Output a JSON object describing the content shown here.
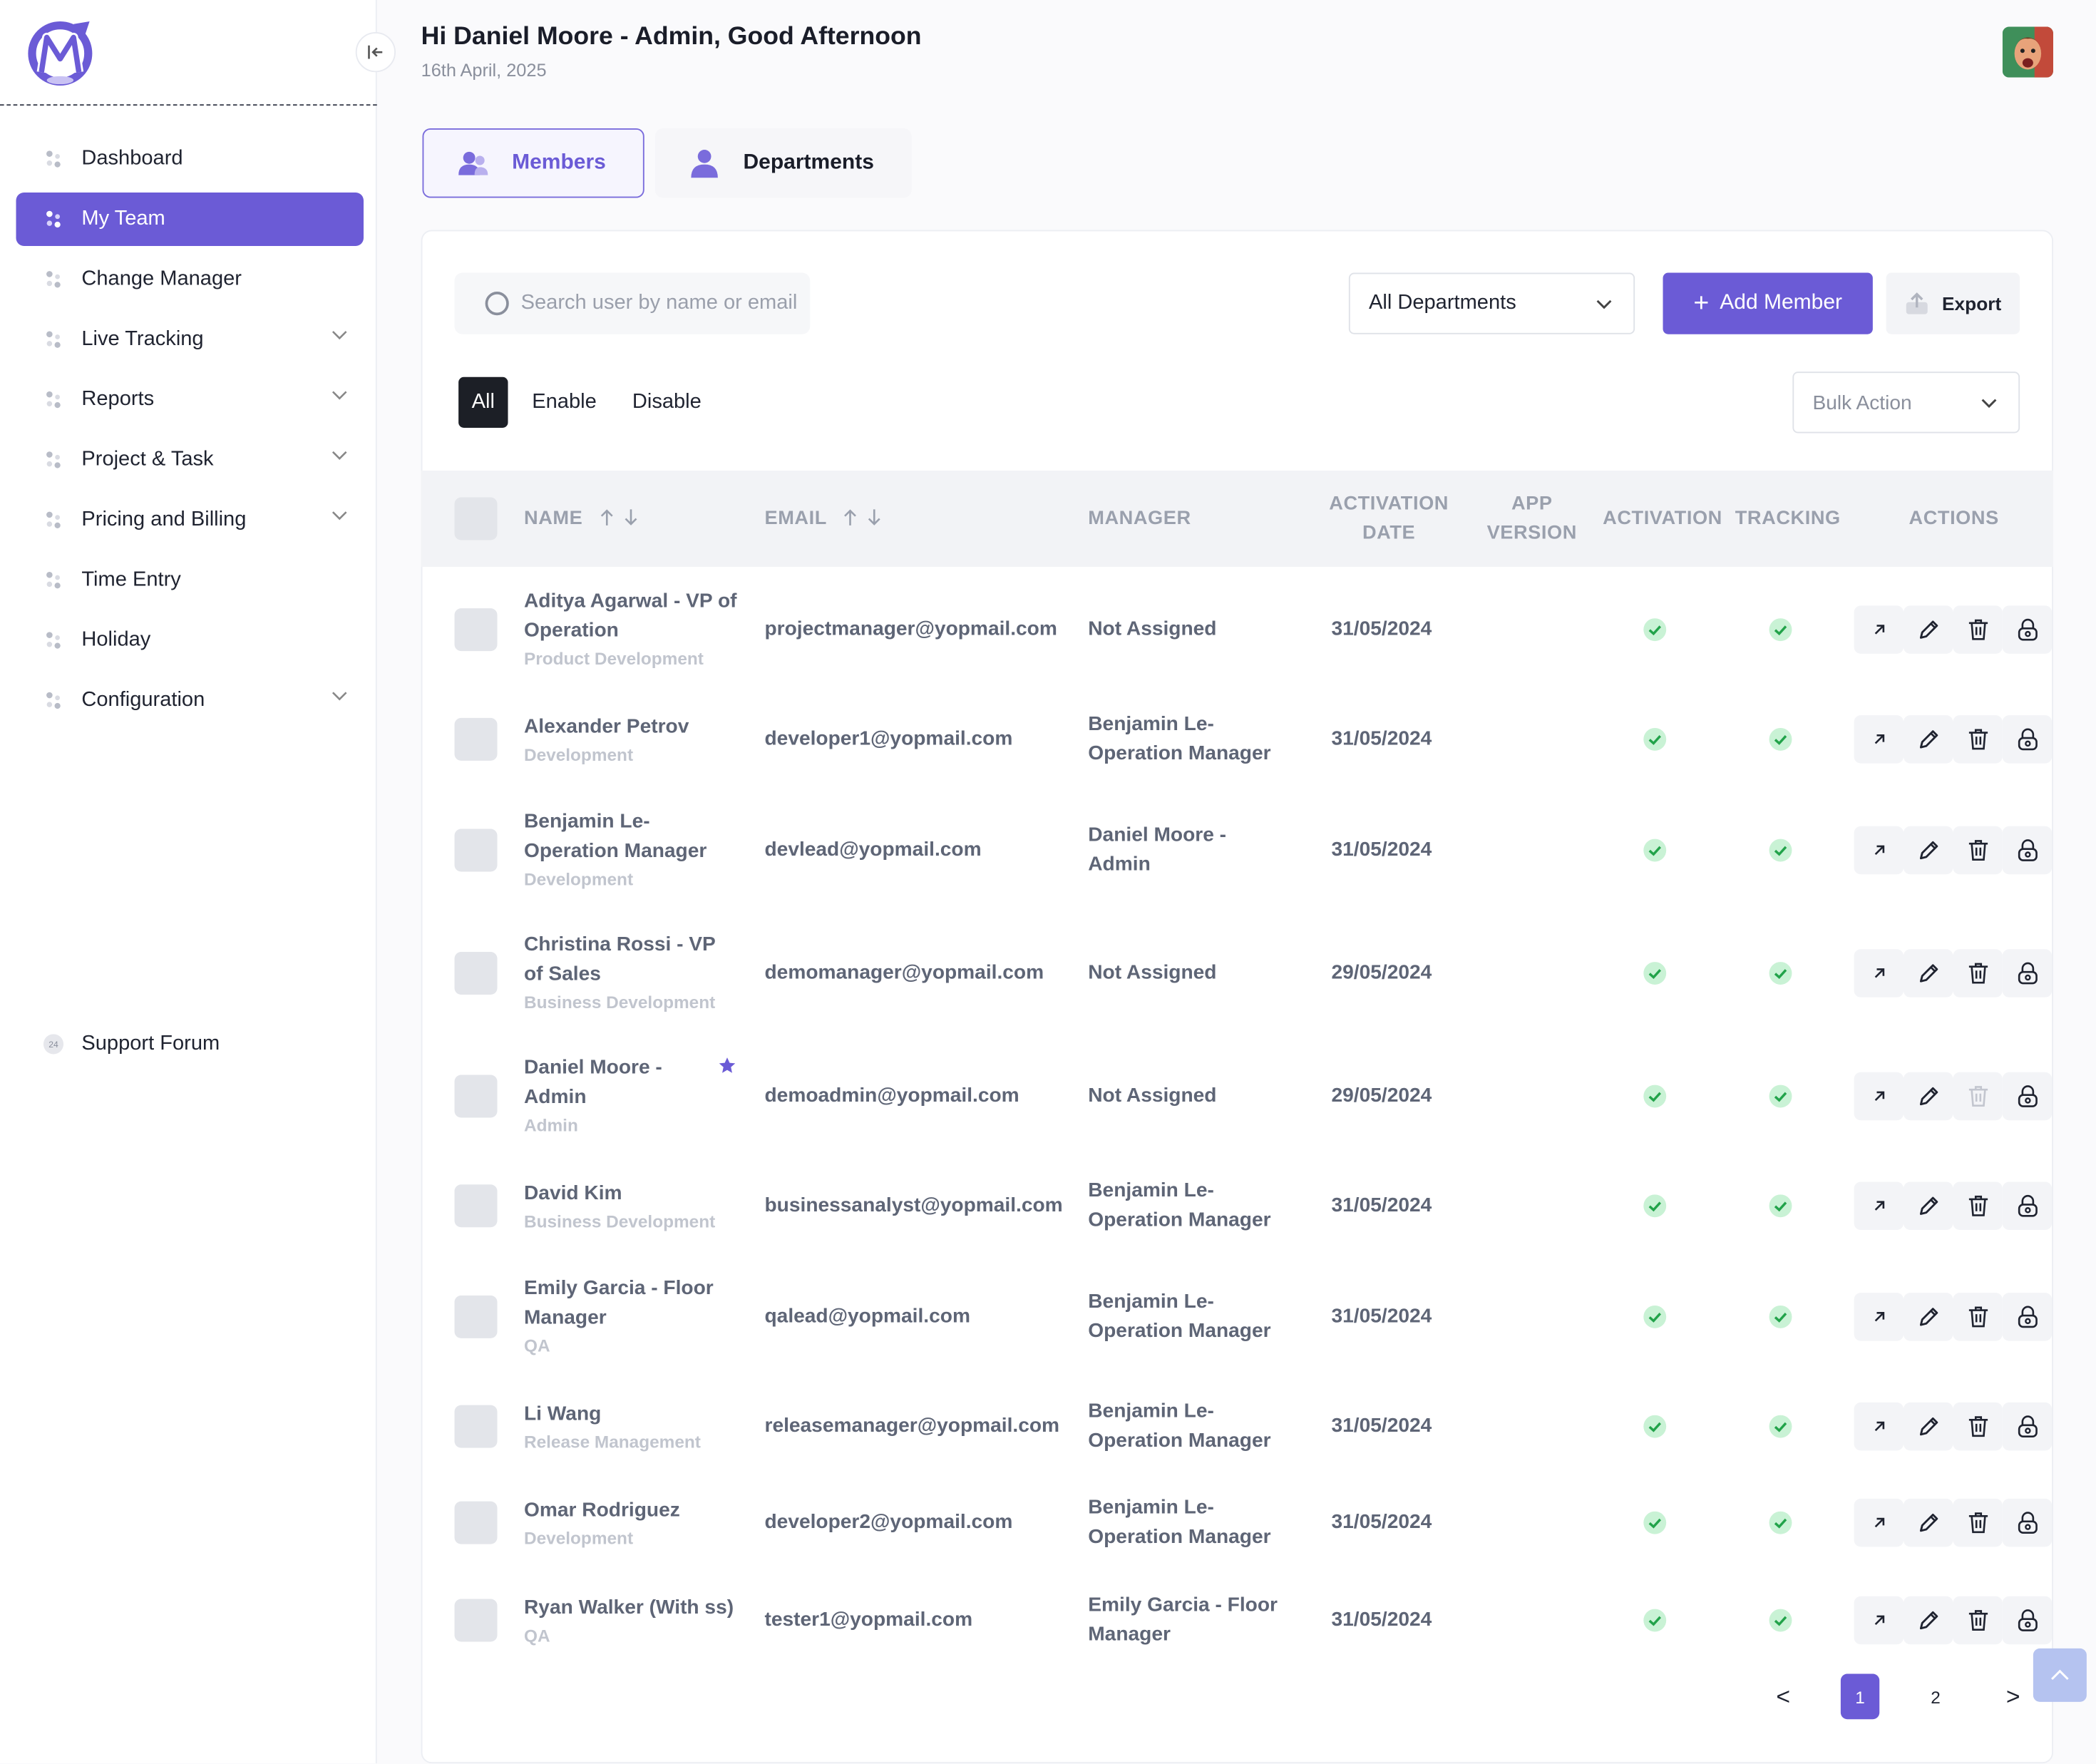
{
  "sidebar": {
    "items": [
      {
        "label": "Dashboard"
      },
      {
        "label": "My Team"
      },
      {
        "label": "Change Manager"
      },
      {
        "label": "Live Tracking"
      },
      {
        "label": "Reports"
      },
      {
        "label": "Project & Task"
      },
      {
        "label": "Pricing and Billing"
      },
      {
        "label": "Time Entry"
      },
      {
        "label": "Holiday"
      },
      {
        "label": "Configuration"
      }
    ],
    "support": {
      "label": "Support Forum",
      "badge": "24"
    }
  },
  "header": {
    "greeting": "Hi Daniel Moore - Admin, Good Afternoon",
    "date": "16th April, 2025"
  },
  "tabs": [
    {
      "label": "Members"
    },
    {
      "label": "Departments"
    }
  ],
  "toolbar": {
    "search_placeholder": "Search user by name or email",
    "department_select": "All Departments",
    "add_label": "Add Member",
    "export_label": "Export",
    "bulk_action": "Bulk Action"
  },
  "filters": [
    {
      "label": "All"
    },
    {
      "label": "Enable"
    },
    {
      "label": "Disable"
    }
  ],
  "table": {
    "headers": {
      "name": "NAME",
      "email": "EMAIL",
      "manager": "MANAGER",
      "activation_date_1": "ACTIVATION",
      "activation_date_2": "DATE",
      "app_version_1": "APP",
      "app_version_2": "VERSION",
      "activation": "ACTIVATION",
      "tracking": "TRACKING",
      "actions": "ACTIONS"
    },
    "rows": [
      {
        "name1": "Aditya Agarwal - VP of",
        "name2": "Operation",
        "dept": "Product Development",
        "email": "projectmanager@yopmail.com",
        "mgr1": "Not Assigned",
        "mgr2": "",
        "date": "31/05/2024",
        "starred": false,
        "delete_enabled": true
      },
      {
        "name1": "Alexander Petrov",
        "name2": "",
        "dept": "Development",
        "email": "developer1@yopmail.com",
        "mgr1": "Benjamin Le-",
        "mgr2": "Operation Manager",
        "date": "31/05/2024",
        "starred": false,
        "delete_enabled": true
      },
      {
        "name1": "Benjamin Le-",
        "name2": "Operation Manager",
        "dept": "Development",
        "email": "devlead@yopmail.com",
        "mgr1": "Daniel Moore -",
        "mgr2": "Admin",
        "date": "31/05/2024",
        "starred": false,
        "delete_enabled": true
      },
      {
        "name1": "Christina Rossi - VP",
        "name2": "of Sales",
        "dept": "Business Development",
        "email": "demomanager@yopmail.com",
        "mgr1": "Not Assigned",
        "mgr2": "",
        "date": "29/05/2024",
        "starred": false,
        "delete_enabled": true
      },
      {
        "name1": "Daniel Moore -",
        "name2": "Admin",
        "dept": "Admin",
        "email": "demoadmin@yopmail.com",
        "mgr1": "Not Assigned",
        "mgr2": "",
        "date": "29/05/2024",
        "starred": true,
        "delete_enabled": false
      },
      {
        "name1": "David Kim",
        "name2": "",
        "dept": "Business Development",
        "email": "businessanalyst@yopmail.com",
        "mgr1": "Benjamin Le-",
        "mgr2": "Operation Manager",
        "date": "31/05/2024",
        "starred": false,
        "delete_enabled": true
      },
      {
        "name1": "Emily Garcia - Floor",
        "name2": "Manager",
        "dept": "QA",
        "email": "qalead@yopmail.com",
        "mgr1": "Benjamin Le-",
        "mgr2": "Operation Manager",
        "date": "31/05/2024",
        "starred": false,
        "delete_enabled": true
      },
      {
        "name1": "Li Wang",
        "name2": "",
        "dept": "Release Management",
        "email": "releasemanager@yopmail.com",
        "mgr1": "Benjamin Le-",
        "mgr2": "Operation Manager",
        "date": "31/05/2024",
        "starred": false,
        "delete_enabled": true
      },
      {
        "name1": "Omar Rodriguez",
        "name2": "",
        "dept": "Development",
        "email": "developer2@yopmail.com",
        "mgr1": "Benjamin Le-",
        "mgr2": "Operation Manager",
        "date": "31/05/2024",
        "starred": false,
        "delete_enabled": true
      },
      {
        "name1": "Ryan Walker (With ss)",
        "name2": "",
        "dept": "QA",
        "email": "tester1@yopmail.com",
        "mgr1": "Emily Garcia - Floor",
        "mgr2": "Manager",
        "date": "31/05/2024",
        "starred": false,
        "delete_enabled": true
      }
    ]
  },
  "pagination": {
    "prev": "<",
    "pages": [
      "1",
      "2"
    ],
    "current": "1",
    "next": ">"
  },
  "colors": {
    "accent": "#6b5bd6",
    "success": "#4ade80",
    "dark": "#1c1f26"
  }
}
